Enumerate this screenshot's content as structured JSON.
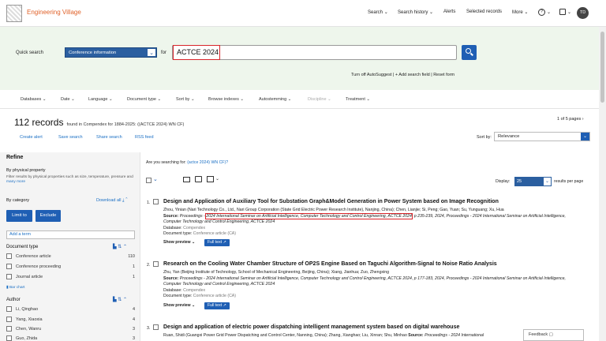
{
  "header": {
    "brand": "Engineering Village",
    "nav": {
      "search": "Search",
      "search_history": "Search history",
      "alerts": "Alerts",
      "selected_records": "Selected records",
      "more": "More",
      "help": "?",
      "avatar": "TD"
    }
  },
  "search": {
    "quick_search_label": "Quick search",
    "field": "Conference information",
    "for_label": "for",
    "query": "ACTCE 2024",
    "options": "Turn off AutoSuggest | + Add search field | Reset form"
  },
  "filters": [
    {
      "label": "Databases",
      "disabled": false
    },
    {
      "label": "Date",
      "disabled": false
    },
    {
      "label": "Language",
      "disabled": false
    },
    {
      "label": "Document type",
      "disabled": false
    },
    {
      "label": "Sort by",
      "disabled": false
    },
    {
      "label": "Browse indexes",
      "disabled": false
    },
    {
      "label": "Autostemming",
      "disabled": false
    },
    {
      "label": "Discipline",
      "disabled": true
    },
    {
      "label": "Treatment",
      "disabled": false
    }
  ],
  "results_header": {
    "count": "112 records",
    "found_in": "found in Compendex for 1884-2025: ((ACTCE 2024) WN CF)",
    "pages": "1 of 5 pages",
    "actions": [
      "Create alert",
      "Save search",
      "Share search",
      "RSS feed"
    ],
    "sort_by_label": "Sort by:",
    "sort_value": "Relevance"
  },
  "refine": {
    "title": "Refine",
    "by_property_title": "By physical property",
    "by_property_desc": "Filter results by physical properties such as size, temperature, pressure and",
    "many_more": "many more",
    "by_category": "By category",
    "download_all": "Download all",
    "limit_to": "Limit to",
    "exclude": "Exclude",
    "add_term": "Add a term",
    "doc_type_title": "Document type",
    "doc_types": [
      {
        "label": "Conference article",
        "count": "110"
      },
      {
        "label": "Conference proceeding",
        "count": "1"
      },
      {
        "label": "Journal article",
        "count": "1"
      }
    ],
    "bar_chart": "Bar chart",
    "author_title": "Author",
    "authors": [
      {
        "label": "Li, Qinghao",
        "count": "4"
      },
      {
        "label": "Yang, Xiaoxia",
        "count": "4"
      },
      {
        "label": "Chen, Wanru",
        "count": "3"
      },
      {
        "label": "Guo, Zhida",
        "count": "3"
      }
    ]
  },
  "results": {
    "did_you_mean_prefix": "Are you searching for:",
    "did_you_mean_link": "(actce 2024) WN CF)?",
    "display_label": "Display:",
    "display_value": "25",
    "per_page": "results per page",
    "items": [
      {
        "num": "1.",
        "title": "Design and Application of Auxiliary Tool for Substation Graph&Model Generation in Power System based on Image Recognition",
        "authors": "Zhou, Yinian (Nari Technology Co., Ltd., Nari Group Corporation (State Grid Electric Power Research Institute), Nanjing, China); Chen, Lianjie; Si, Peng; Gao, Yuan; Su, Yunguang; Xu, Hua",
        "source_label": "Source:",
        "source_pre": "Proceedings",
        "source_hl": "2024 International Seminar on Artificial Intelligence, Computer Technology and Control Engineering, ACTCE 2024",
        "source_post": ", p 235-239, 2024, Proceedings - 2024 International Seminar on Artificial Intelligence, Computer Technology and Control Engineering, ACTCE 2024",
        "database_label": "Database:",
        "database": "Compendex",
        "doctype_label": "Document type:",
        "doctype": "Conference article (CA)",
        "show_preview": "Show preview",
        "full_text": "Full text"
      },
      {
        "num": "2.",
        "title": "Research on the Cooling Water Chamber Structure of OP2S Engine Based on Taguchi Algorithm-Signal to Noise Ratio Analysis",
        "authors": "Zhu, Yan (Beijing Institute of Technology, School of Mechanical Engineering, Beijing, China); Xiang, Jianhua; Zuo, Zhengxing",
        "source_label": "Source:",
        "source_text": "Proceedings - 2024 International Seminar on Artificial Intelligence, Computer Technology and Control Engineering, ACTCE 2024, p 177-183, 2024, Proceedings - 2024 International Seminar on Artificial Intelligence, Computer Technology and Control Engineering, ACTCE 2024",
        "database_label": "Database:",
        "database": "Compendex",
        "doctype_label": "Document type:",
        "doctype": "Conference article (CA)",
        "show_preview": "Show preview",
        "full_text": "Full text"
      },
      {
        "num": "3.",
        "title": "Design and application of electric power dispatching intelligent management system based on digital warehouse",
        "authors": "Ruan, Shidi (Guangxi Power Grid Power Dispatching and Control Center, Nanning, China); Zhang, Xianghao; Liu, Xinran; Shu, Minhao",
        "source_label": "Source:",
        "source_text": "Proceedings - 2024 International"
      }
    ]
  },
  "feedback": "Feedback"
}
